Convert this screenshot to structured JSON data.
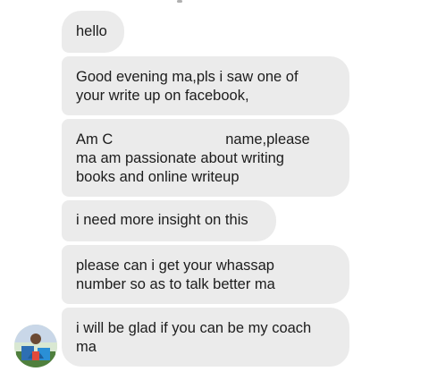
{
  "messages": [
    {
      "lines": [
        "hello"
      ]
    },
    {
      "lines": [
        "Good evening ma,pls i saw one of",
        "your write up on facebook,"
      ]
    },
    {
      "lines_partial": {
        "before": "Am C",
        "after": "name,please"
      },
      "lines": [
        "",
        "ma am passionate about writing",
        "books and online writeup"
      ]
    },
    {
      "lines": [
        "i need more insight on this"
      ]
    },
    {
      "lines": [
        "please can i get your whassap",
        "number so as to talk better ma"
      ]
    },
    {
      "lines": [
        "i will be glad if you can be my coach",
        "ma"
      ]
    }
  ],
  "colors": {
    "bubble_bg": "#ebebeb",
    "text": "#1c1c1c"
  },
  "icons": {
    "sender_avatar": "avatar"
  }
}
